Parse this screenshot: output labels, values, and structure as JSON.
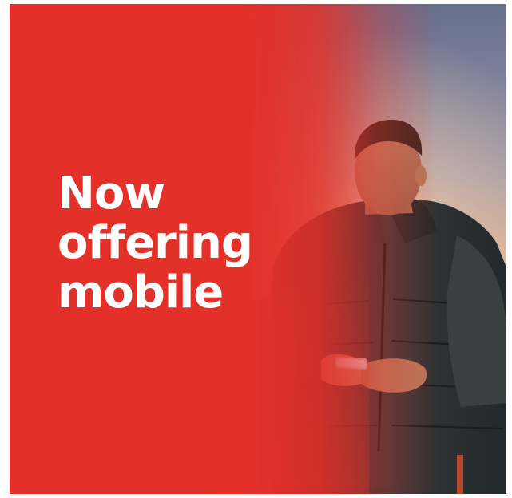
{
  "banner": {
    "headline_lines": [
      "Now",
      "offering",
      "mobile"
    ],
    "colors": {
      "brand_red": "#e3312a",
      "text": "#ffffff",
      "sky_top": "#6f7595",
      "sky_horizon": "#e8a07a",
      "jacket": "#2b2f30"
    },
    "photo_subject": "man-looking-at-phone-icon"
  }
}
